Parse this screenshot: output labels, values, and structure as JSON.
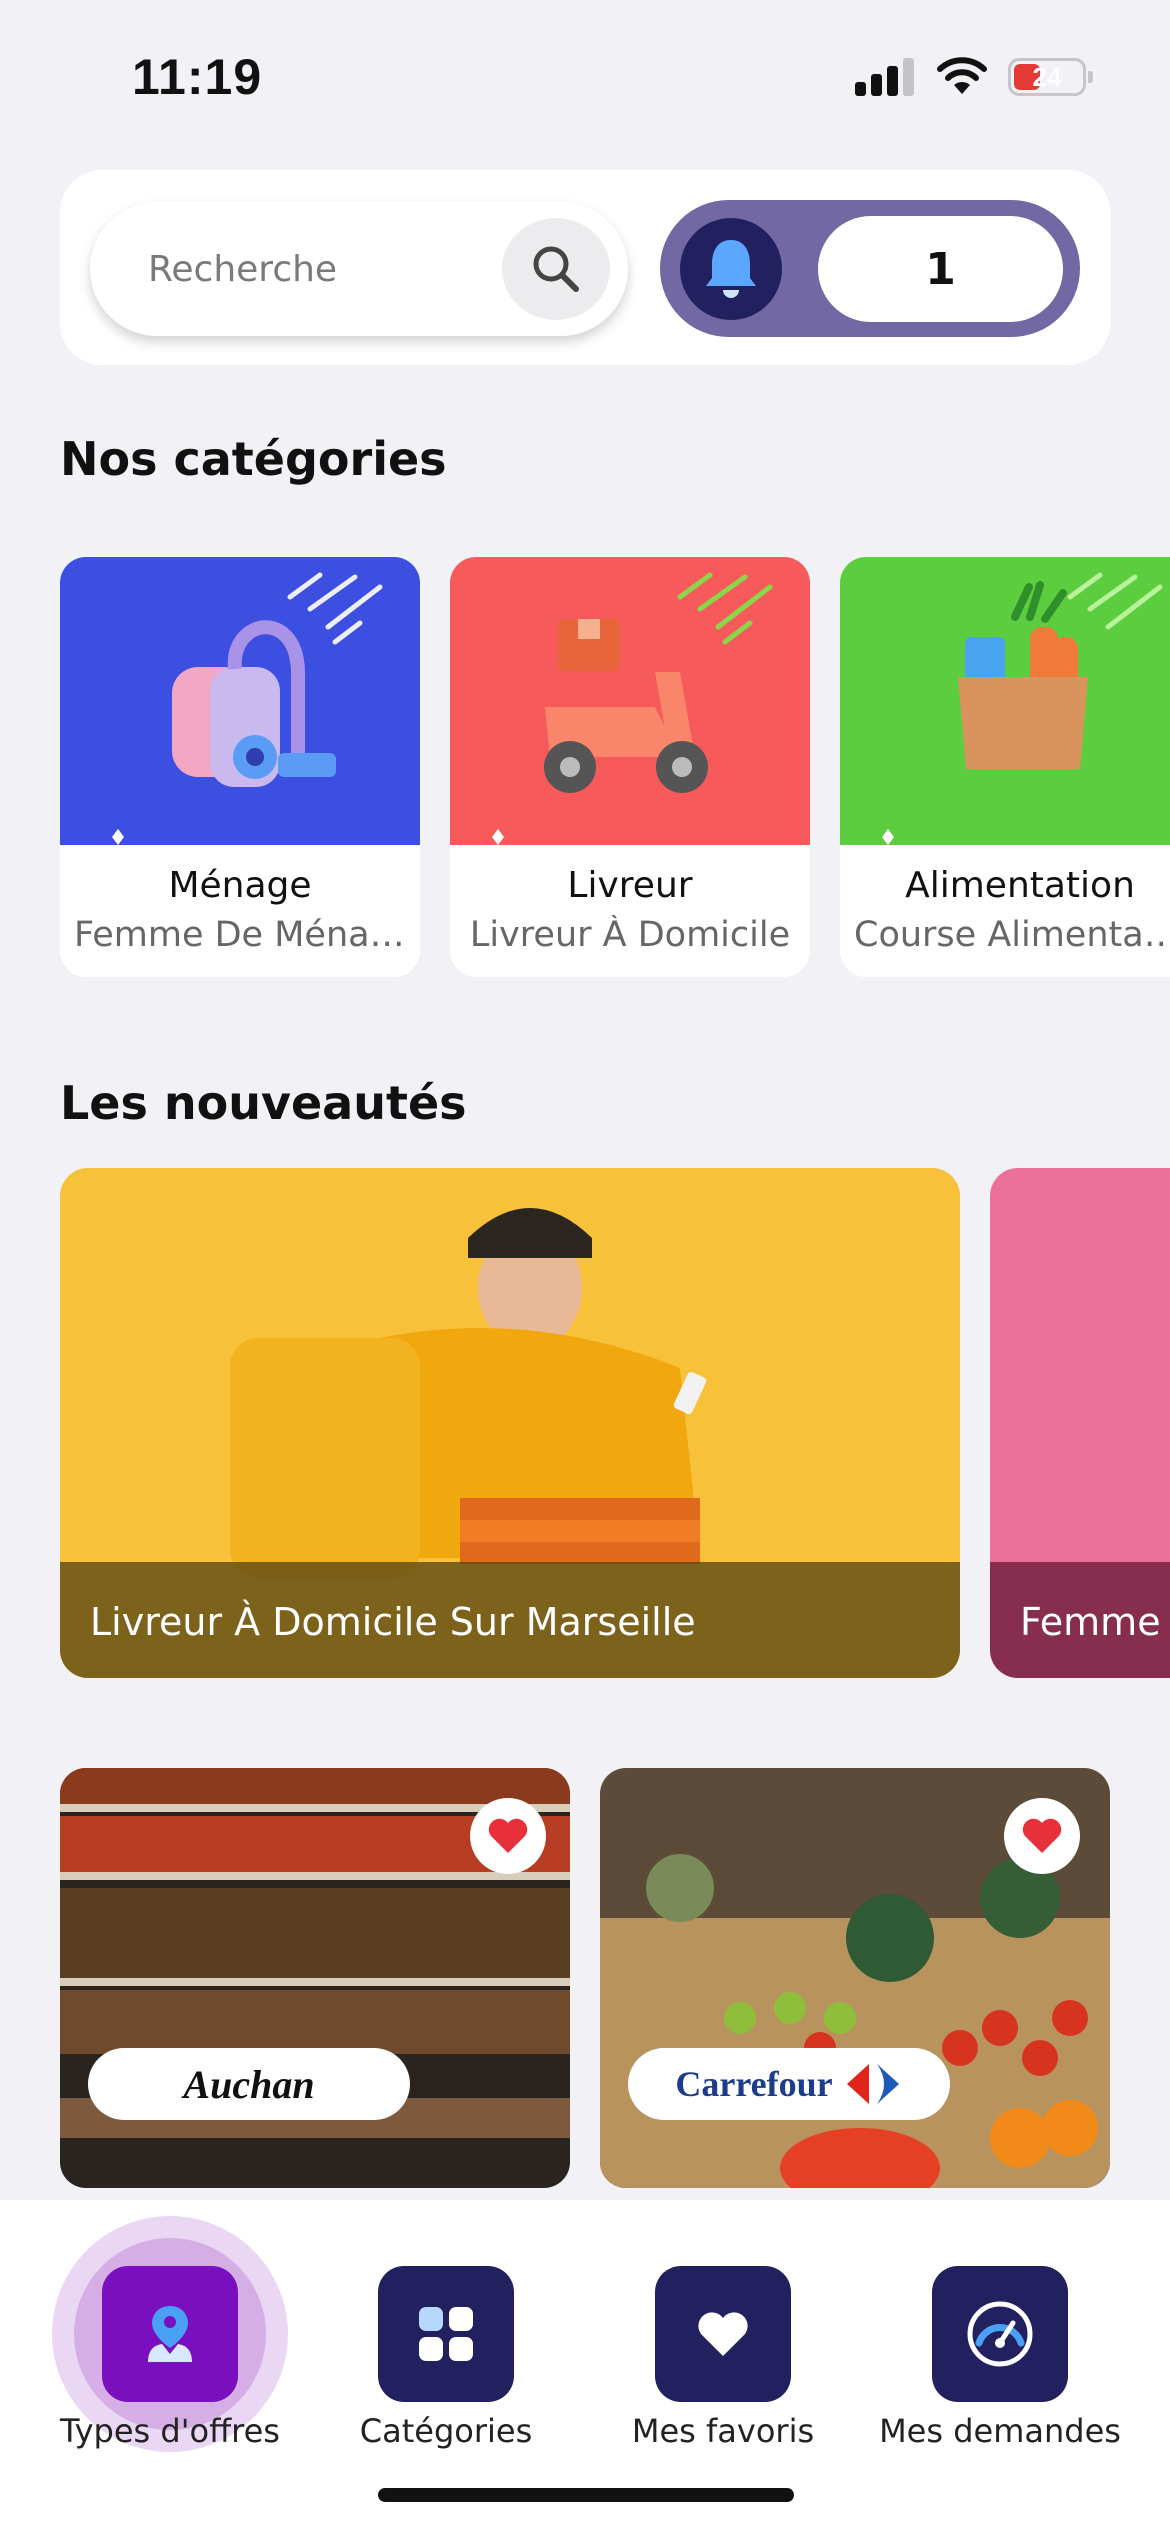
{
  "status_bar": {
    "time": "11:19",
    "battery": "24"
  },
  "search": {
    "placeholder": "Recherche"
  },
  "notifications": {
    "count": "1"
  },
  "categories": {
    "title": "Nos catégories",
    "items": [
      {
        "title": "Ménage",
        "subtitle": "Femme De Ménage",
        "color": "#3c4fe0",
        "icon": "vacuum-cleaner-icon"
      },
      {
        "title": "Livreur",
        "subtitle": "Livreur À Domicile",
        "color": "#f75a5a",
        "icon": "delivery-scooter-icon"
      },
      {
        "title": "Alimentation",
        "subtitle": "Course Alimentaire",
        "color": "#5ccd3f",
        "icon": "grocery-bag-icon"
      }
    ]
  },
  "news": {
    "title": "Les nouveautés",
    "items": [
      {
        "caption": "Livreur À Domicile Sur Marseille"
      },
      {
        "caption": "Femme"
      }
    ]
  },
  "stores": [
    {
      "brand": "Auchan",
      "favorite": true
    },
    {
      "brand": "Carrefour",
      "favorite": true
    }
  ],
  "bottom_nav": {
    "items": [
      {
        "label": "Types d'offres",
        "icon": "map-pin-person-icon",
        "active": true
      },
      {
        "label": "Catégories",
        "icon": "grid-icon",
        "active": false
      },
      {
        "label": "Mes favoris",
        "icon": "heart-icon",
        "active": false
      },
      {
        "label": "Mes demandes",
        "icon": "speedometer-icon",
        "active": false
      }
    ]
  },
  "colors": {
    "accent": "#22205f",
    "active": "#7a0fbf",
    "notif": "#7168a4"
  }
}
